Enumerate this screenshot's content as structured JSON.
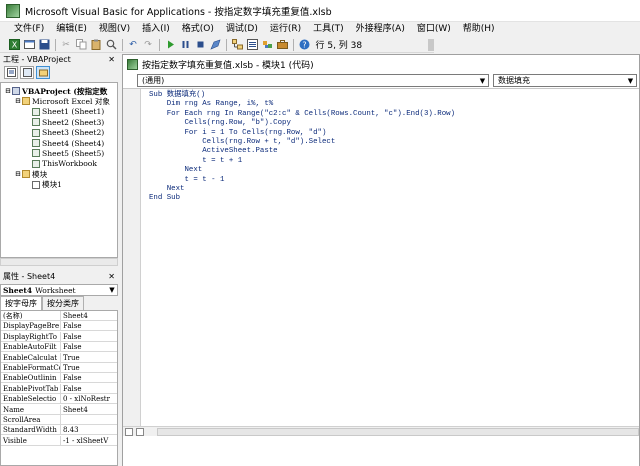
{
  "window": {
    "title": "Microsoft Visual Basic for Applications - 按指定数字填充重复值.xlsb"
  },
  "menu": [
    "文件(F)",
    "编辑(E)",
    "视图(V)",
    "插入(I)",
    "格式(O)",
    "调试(D)",
    "运行(R)",
    "工具(T)",
    "外接程序(A)",
    "窗口(W)",
    "帮助(H)"
  ],
  "toolbar": {
    "position": "行 5, 列 38"
  },
  "project_panel": {
    "title": "工程 - VBAProject",
    "tree": [
      {
        "label": "VBAProject (按指定数",
        "level": 0,
        "icon": "project",
        "expander": "⊟",
        "bold": true
      },
      {
        "label": "Microsoft Excel 对象",
        "level": 1,
        "icon": "folder",
        "expander": "⊟",
        "bold": false
      },
      {
        "label": "Sheet1 (Sheet1)",
        "level": 2,
        "icon": "sheet",
        "expander": "",
        "bold": false
      },
      {
        "label": "Sheet2 (Sheet3)",
        "level": 2,
        "icon": "sheet",
        "expander": "",
        "bold": false
      },
      {
        "label": "Sheet3 (Sheet2)",
        "level": 2,
        "icon": "sheet",
        "expander": "",
        "bold": false
      },
      {
        "label": "Sheet4 (Sheet4)",
        "level": 2,
        "icon": "sheet",
        "expander": "",
        "bold": false
      },
      {
        "label": "Sheet5 (Sheet5)",
        "level": 2,
        "icon": "sheet",
        "expander": "",
        "bold": false
      },
      {
        "label": "ThisWorkbook",
        "level": 2,
        "icon": "sheet",
        "expander": "",
        "bold": false
      },
      {
        "label": "模块",
        "level": 1,
        "icon": "folder",
        "expander": "⊟",
        "bold": false
      },
      {
        "label": "模块1",
        "level": 2,
        "icon": "module",
        "expander": "",
        "bold": false
      }
    ]
  },
  "properties_panel": {
    "title": "属性 - Sheet4",
    "object_name": "Sheet4",
    "object_type": "Worksheet",
    "tabs": [
      "按字母序",
      "按分类序"
    ],
    "rows": [
      {
        "name": "(名称)",
        "value": "Sheet4"
      },
      {
        "name": "DisplayPageBre",
        "value": "False"
      },
      {
        "name": "DisplayRightTo",
        "value": "False"
      },
      {
        "name": "EnableAutoFilt",
        "value": "False"
      },
      {
        "name": "EnableCalculat",
        "value": "True"
      },
      {
        "name": "EnableFormatCo",
        "value": "True"
      },
      {
        "name": "EnableOutlinin",
        "value": "False"
      },
      {
        "name": "EnablePivotTab",
        "value": "False"
      },
      {
        "name": "EnableSelectio",
        "value": "0 - xlNoRestr"
      },
      {
        "name": "Name",
        "value": "Sheet4"
      },
      {
        "name": "ScrollArea",
        "value": ""
      },
      {
        "name": "StandardWidth",
        "value": "8.43"
      },
      {
        "name": "Visible",
        "value": "-1 - xlSheetV"
      }
    ]
  },
  "code_window": {
    "title": "按指定数字填充重复值.xlsb - 模块1 (代码)",
    "object_combo": "(通用)",
    "proc_combo": "数据填充",
    "code_lines": [
      "Sub 数据填充()",
      "    Dim rng As Range, i%, t%",
      "    For Each rng In Range(\"c2:c\" & Cells(Rows.Count, \"c\").End(3).Row)",
      "        Cells(rng.Row, \"b\").Copy",
      "        For i = 1 To Cells(rng.Row, \"d\")",
      "            Cells(rng.Row + t, \"d\").Select",
      "            ActiveSheet.Paste",
      "            t = t + 1",
      "        Next",
      "        t = t - 1",
      "    Next",
      "End Sub"
    ]
  }
}
